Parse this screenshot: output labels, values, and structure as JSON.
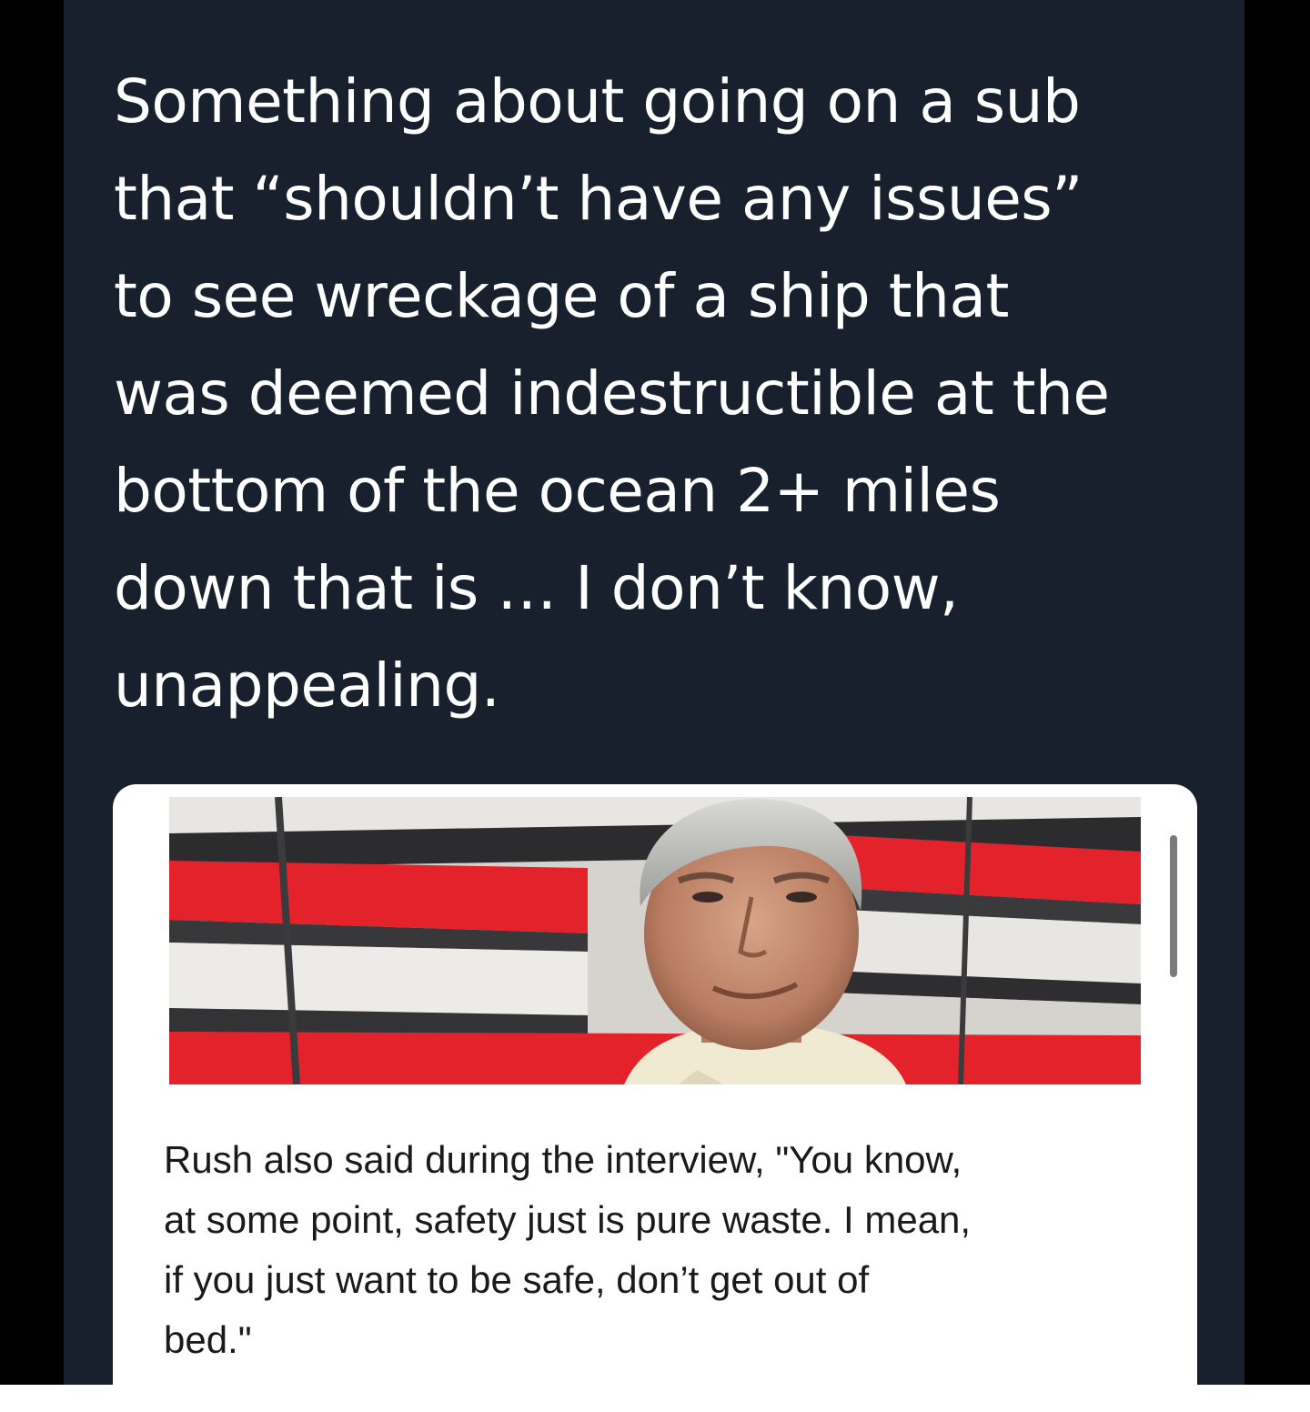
{
  "tweet": {
    "text": "Something about going on a sub\nthat “shouldn’t have any issues”\nto see wreckage of a ship that\nwas deemed indestructible at the\nbottom of the ocean 2+ miles\ndown that is … I don’t know,\nunappealing."
  },
  "quoted_card": {
    "caption": "Rush also said during the interview, \"You know,\nat some point, safety just is pure waste. I mean,\nif you just want to be safe, don’t get out of\nbed.\""
  },
  "colors": {
    "tweet_background": "#17202c",
    "frame": "#000000",
    "card_background": "#ffffff",
    "flag_red": "#e3222b"
  }
}
